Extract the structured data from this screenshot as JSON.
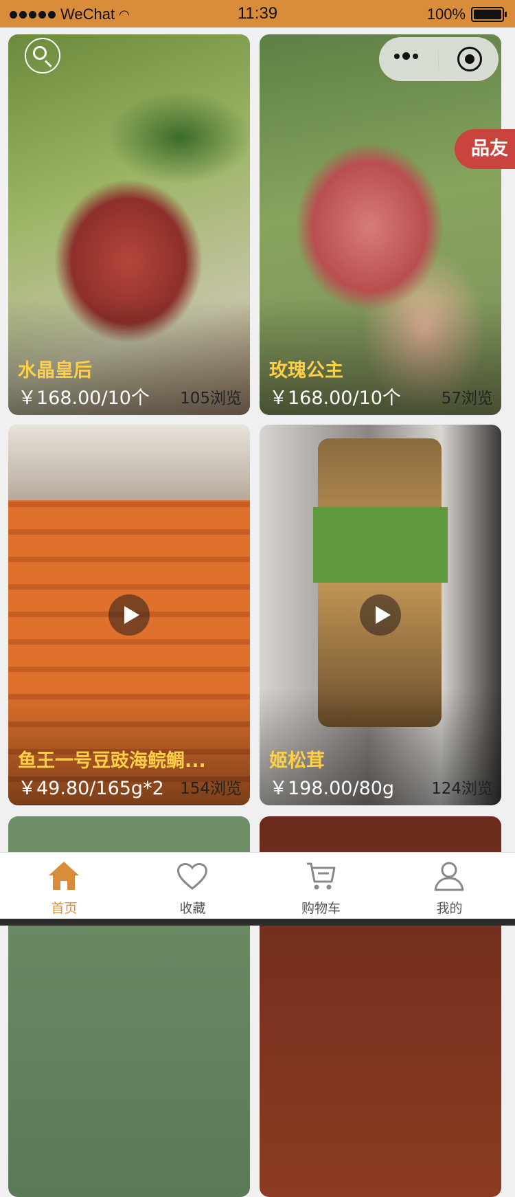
{
  "status_bar": {
    "carrier": "WeChat",
    "time": "11:39",
    "battery": "100%"
  },
  "floating_tab": {
    "label": "品友"
  },
  "products": [
    {
      "name": "水晶皇后",
      "price": "￥168.00/10个",
      "views": "105浏览",
      "has_video": false
    },
    {
      "name": "玫瑰公主",
      "price": "￥168.00/10个",
      "views": "57浏览",
      "has_video": false
    },
    {
      "name": "鱼王一号豆豉海鲩鲷...",
      "price": "￥49.80/165g*2",
      "views": "154浏览",
      "has_video": true
    },
    {
      "name": "姬松茸",
      "price": "￥198.00/80g",
      "views": "124浏览",
      "has_video": true
    }
  ],
  "tabbar": {
    "items": [
      {
        "label": "首页",
        "icon": "home-icon",
        "active": true
      },
      {
        "label": "收藏",
        "icon": "heart-icon",
        "active": false
      },
      {
        "label": "购物车",
        "icon": "cart-icon",
        "active": false
      },
      {
        "label": "我的",
        "icon": "user-icon",
        "active": false
      }
    ]
  },
  "colors": {
    "accent": "#d98c3a",
    "name_text": "#ffcf4a",
    "pin_tab": "#c9433f"
  }
}
